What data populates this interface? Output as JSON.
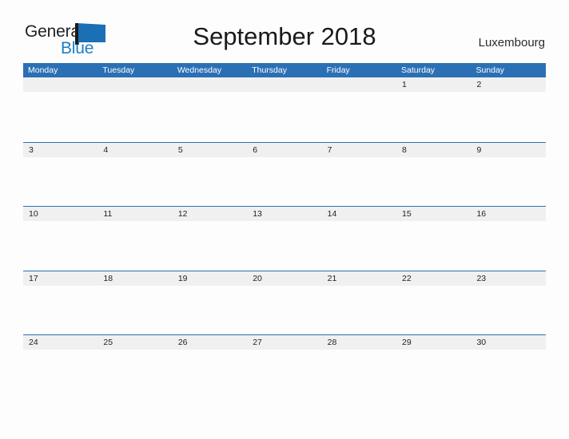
{
  "brand": {
    "name_part1": "General",
    "name_part2": "Blue",
    "flag_icon": "blue-triangle-flag-icon"
  },
  "header": {
    "title": "September 2018",
    "country": "Luxembourg"
  },
  "colors": {
    "header_blue": "#2b70b4",
    "band_gray": "#f0f0f0",
    "brand_blue": "#1f7fc4",
    "text_dark": "#1a1a1a",
    "page_background": "#fdfdfd"
  },
  "calendar": {
    "month": "September",
    "year": "2018",
    "weekdays": [
      "Monday",
      "Tuesday",
      "Wednesday",
      "Thursday",
      "Friday",
      "Saturday",
      "Sunday"
    ],
    "weeks": [
      [
        "",
        "",
        "",
        "",
        "",
        "1",
        "2"
      ],
      [
        "3",
        "4",
        "5",
        "6",
        "7",
        "8",
        "9"
      ],
      [
        "10",
        "11",
        "12",
        "13",
        "14",
        "15",
        "16"
      ],
      [
        "17",
        "18",
        "19",
        "20",
        "21",
        "22",
        "23"
      ],
      [
        "24",
        "25",
        "26",
        "27",
        "28",
        "29",
        "30"
      ]
    ]
  }
}
